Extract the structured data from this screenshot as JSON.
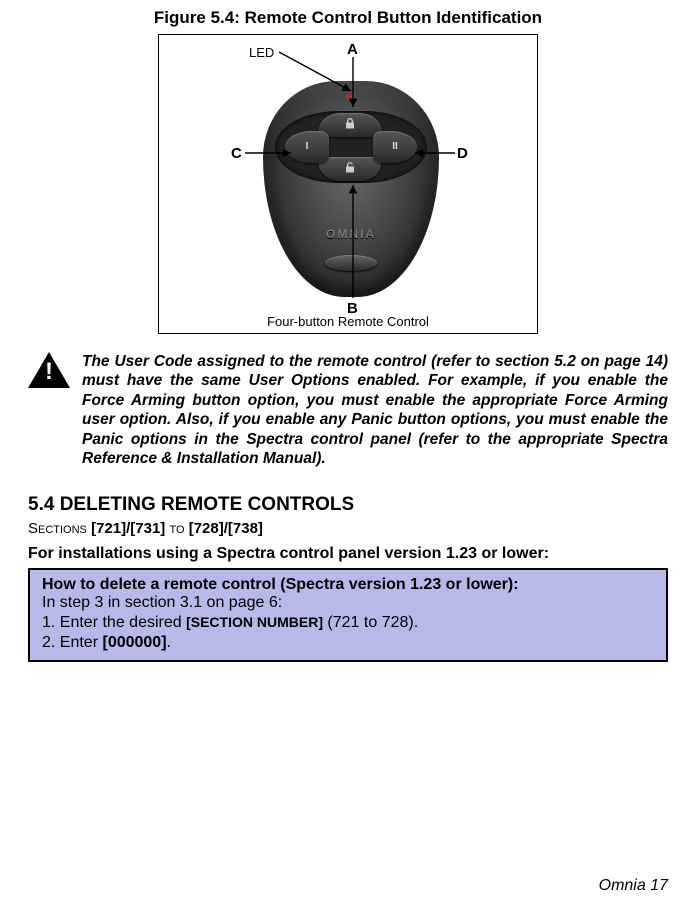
{
  "figure": {
    "title": "Figure 5.4: Remote Control Button Identification",
    "led_label": "LED",
    "label_a": "A",
    "label_b": "B",
    "label_c": "C",
    "label_d": "D",
    "sub_caption": "Four-button Remote Control",
    "brand": "OMNIA",
    "btn_top_icon": "lock",
    "btn_bottom_icon": "unlock",
    "btn_left_icon": "I",
    "btn_right_icon": "II"
  },
  "warning": {
    "text": "The User Code assigned to the remote control (refer to section 5.2 on page 14) must have the same User Options enabled. For example, if you enable the Force Arming button option, you must enable the appropriate Force Arming user option. Also, if you enable any Panic button options, you must enable the Panic options in the Spectra control panel (refer to the appropriate Spectra Reference & Installation Manual)."
  },
  "section": {
    "heading": "5.4 DELETING REMOTE CONTROLS",
    "sections_prefix": "Sections",
    "sections_bold1": " [721]/[731] ",
    "sections_to": "to",
    "sections_bold2": " [728]/[738]",
    "for_install": "For installations using a Spectra control panel version 1.23 or lower:"
  },
  "howto": {
    "title": "How to delete a remote control (Spectra version 1.23 or lower):",
    "line1": "In step 3 in section 3.1 on page 6:",
    "step1_pre": "1. Enter the desired ",
    "step1_kw": "[SECTION NUMBER]",
    "step1_post": " (721 to 728).",
    "step2_pre": "2. Enter ",
    "step2_kw": "[000000]",
    "step2_post": "."
  },
  "footer": "Omnia 17"
}
